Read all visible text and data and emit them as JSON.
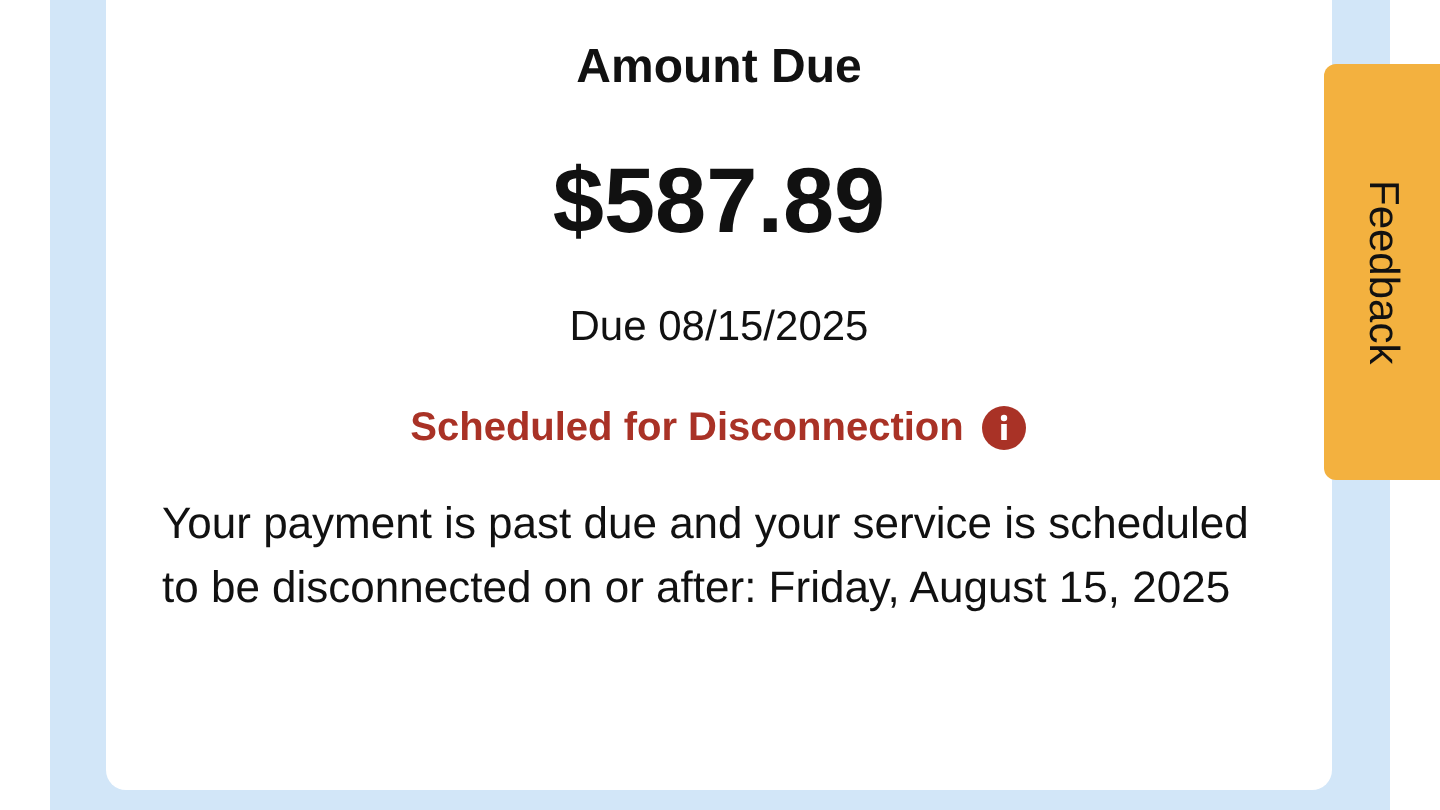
{
  "bill": {
    "title": "Amount Due",
    "amount": "$587.89",
    "due_date": "Due 08/15/2025",
    "status": "Scheduled for Disconnection",
    "message": "Your payment is past due and your service is scheduled to be disconnected on or after: Friday, August 15, 2025"
  },
  "feedback_tab": {
    "label": "Feedback"
  }
}
